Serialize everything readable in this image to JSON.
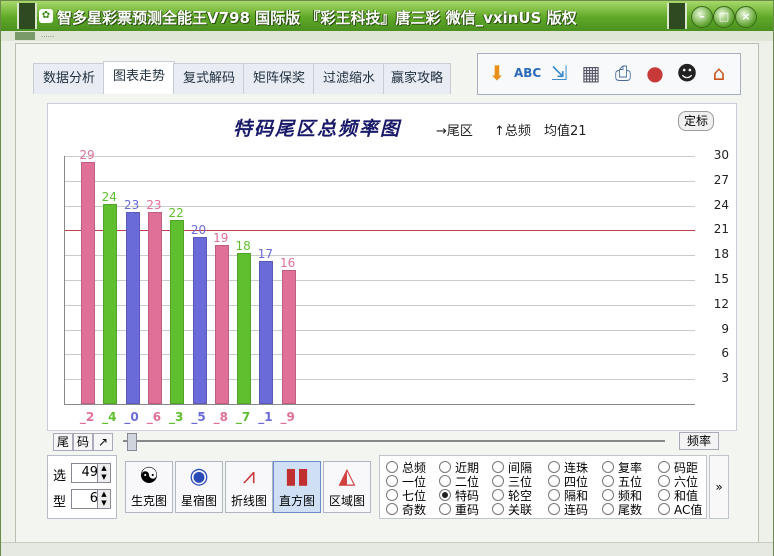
{
  "window": {
    "title": "智多星彩票预测全能王V798 国际版 『彩王科技』唐三彩 微信_vxinUS 版权",
    "sub_text": "......",
    "min_label": "–",
    "max_label": "□",
    "close_label": "×"
  },
  "tabs": [
    {
      "label": "数据分析"
    },
    {
      "label": "图表走势"
    },
    {
      "label": "复式解码"
    },
    {
      "label": "矩阵保奖"
    },
    {
      "label": "过滤缩水"
    },
    {
      "label": "赢家攻略"
    }
  ],
  "toolbar": {
    "icons": [
      "arrow-down-icon",
      "spellcheck-icon",
      "export-icon",
      "calculator-icon",
      "printer-icon",
      "gumball-icon",
      "qq-penguin-icon",
      "home-icon"
    ]
  },
  "chart": {
    "title": "特码尾区总频率图",
    "legend_x": "→尾区",
    "legend_y": "↑总频",
    "legend_avg": "均值21",
    "fix_button": "定标"
  },
  "chart_data": {
    "type": "bar",
    "categories": [
      "_2",
      "_4",
      "_0",
      "_6",
      "_3",
      "_5",
      "_8",
      "_7",
      "_1",
      "_9"
    ],
    "values": [
      29,
      24,
      23,
      23,
      22,
      20,
      19,
      18,
      17,
      16
    ],
    "colors": [
      "#e07098",
      "#5fbf2f",
      "#6a6ad8",
      "#e07098",
      "#5fbf2f",
      "#6a6ad8",
      "#e07098",
      "#5fbf2f",
      "#6a6ad8",
      "#e07098"
    ],
    "average": 21,
    "ylim": [
      0,
      30
    ],
    "yticks": [
      3,
      6,
      9,
      12,
      15,
      18,
      21,
      24,
      27,
      30
    ],
    "grid": true
  },
  "controls": {
    "tail_btn": "尾",
    "code_btn": "码",
    "arrow_btn": "↗",
    "freq_btn": "频率"
  },
  "spinners": {
    "select_label": "选",
    "select_value": "49",
    "type_label": "型",
    "type_value": "6"
  },
  "views": [
    {
      "label": "生克图",
      "icon": "yinyang-icon"
    },
    {
      "label": "星宿图",
      "icon": "globe-icon"
    },
    {
      "label": "折线图",
      "icon": "line-chart-icon"
    },
    {
      "label": "直方图",
      "icon": "histogram-icon"
    },
    {
      "label": "区域图",
      "icon": "area-chart-icon"
    }
  ],
  "radio_options": [
    [
      "总频",
      "近期",
      "间隔",
      "连珠",
      "复率",
      "码距"
    ],
    [
      "一位",
      "二位",
      "三位",
      "四位",
      "五位",
      "六位"
    ],
    [
      "七位",
      "特码",
      "轮空",
      "隔和",
      "频和",
      "和值"
    ],
    [
      "奇数",
      "重码",
      "关联",
      "连码",
      "尾数",
      "AC值"
    ]
  ],
  "selected_radio": "特码",
  "more_label": "»"
}
